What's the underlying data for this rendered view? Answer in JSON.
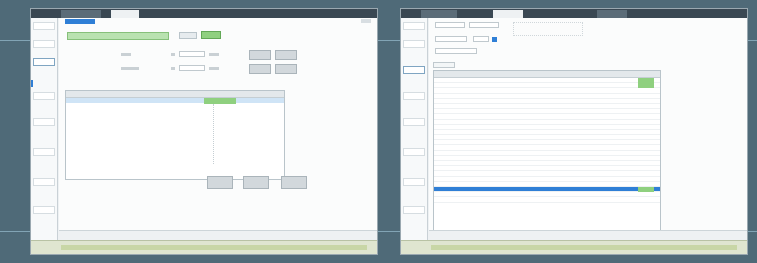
{
  "left_screen": {
    "titlebar_tabs": [
      "",
      ""
    ],
    "breadcrumb_active": "",
    "toolbar": {
      "btn1": "",
      "btn2": ""
    },
    "green_bar_text": "",
    "green_button": "",
    "form": {
      "label_a": "",
      "label_b": "",
      "value_a": "",
      "value_b": ""
    },
    "right_buttons": [
      "",
      "",
      "",
      ""
    ],
    "panel_header": "",
    "panel_rows": [
      "",
      "",
      "",
      "",
      "",
      "",
      "",
      "",
      "",
      "",
      "",
      "",
      "",
      ""
    ],
    "action_buttons": [
      "",
      "",
      ""
    ],
    "zoom": ""
  },
  "right_screen": {
    "titlebar_tabs": [
      "",
      "",
      ""
    ],
    "header_fields": [
      "",
      "",
      "",
      "",
      ""
    ],
    "tab_label": "",
    "table_headers": [
      "",
      "",
      "",
      "",
      "",
      "",
      "",
      ""
    ],
    "rows": [
      [
        "",
        "",
        "",
        ""
      ],
      [
        "",
        "",
        "",
        ""
      ],
      [
        "",
        "",
        "",
        ""
      ],
      [
        "",
        "",
        "",
        ""
      ],
      [
        "",
        "",
        "",
        ""
      ],
      [
        "",
        "",
        "",
        ""
      ],
      [
        "",
        "",
        "",
        ""
      ],
      [
        "",
        "",
        "",
        ""
      ],
      [
        "",
        "",
        "",
        ""
      ],
      [
        "",
        "",
        "",
        ""
      ],
      [
        "",
        "",
        "",
        ""
      ],
      [
        "",
        "",
        "",
        ""
      ],
      [
        "",
        "",
        "",
        ""
      ],
      [
        "",
        "",
        "",
        ""
      ],
      [
        "",
        "",
        "",
        ""
      ],
      [
        "",
        "",
        "",
        ""
      ],
      [
        "",
        "",
        "",
        ""
      ],
      [
        "",
        "",
        "",
        ""
      ],
      [
        "",
        "",
        "",
        ""
      ],
      [
        "",
        "",
        "",
        ""
      ],
      [
        "",
        "",
        "",
        ""
      ],
      [
        "",
        "",
        "",
        ""
      ],
      [
        "",
        "",
        "",
        ""
      ],
      [
        "",
        "",
        "",
        ""
      ]
    ],
    "zoom": ""
  },
  "colors": {
    "background": "#4f6a78",
    "accent_blue": "#2f7fd6",
    "highlight_green": "#8fd07f",
    "status_bar": "#dfe5d0"
  }
}
